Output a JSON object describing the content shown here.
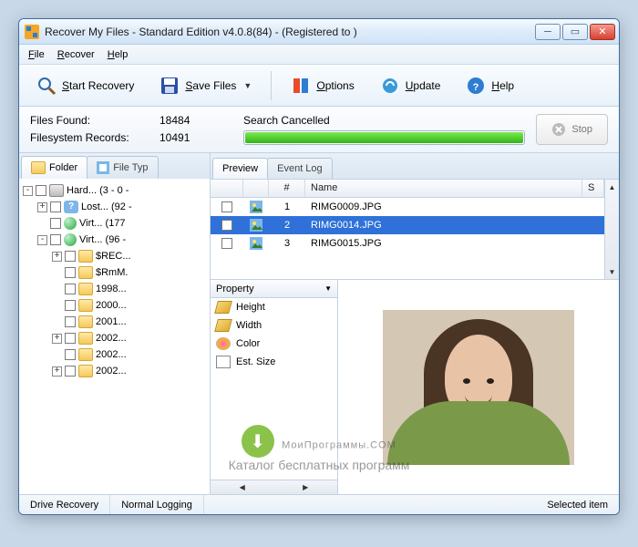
{
  "window": {
    "title": "Recover My Files - Standard Edition v4.0.8(84)  -  (Registered to )"
  },
  "menu": {
    "file": "File",
    "recover": "Recover",
    "help": "Help"
  },
  "toolbar": {
    "start_recovery": "Start Recovery",
    "save_files": "Save Files",
    "options": "Options",
    "update": "Update",
    "help": "Help"
  },
  "status": {
    "files_found_label": "Files Found:",
    "files_found_value": "18484",
    "fs_records_label": "Filesystem Records:",
    "fs_records_value": "10491",
    "search_state": "Search Cancelled",
    "stop_label": "Stop"
  },
  "left_tabs": {
    "folder": "Folder",
    "file_type": "File Typ"
  },
  "tree": [
    {
      "indent": 0,
      "exp": "-",
      "icon": "drive",
      "label": "Hard... (3 - 0 - "
    },
    {
      "indent": 1,
      "exp": "+",
      "icon": "q",
      "label": "Lost... (92 -"
    },
    {
      "indent": 1,
      "exp": " ",
      "icon": "globe",
      "label": "Virt... (177"
    },
    {
      "indent": 1,
      "exp": "-",
      "icon": "globe",
      "label": "Virt... (96 -"
    },
    {
      "indent": 2,
      "exp": "+",
      "icon": "folder",
      "label": "$REC..."
    },
    {
      "indent": 2,
      "exp": " ",
      "icon": "folder",
      "label": "$RmM."
    },
    {
      "indent": 2,
      "exp": " ",
      "icon": "folder",
      "label": "1998..."
    },
    {
      "indent": 2,
      "exp": " ",
      "icon": "folder",
      "label": "2000..."
    },
    {
      "indent": 2,
      "exp": " ",
      "icon": "folder",
      "label": "2001..."
    },
    {
      "indent": 2,
      "exp": "+",
      "icon": "folder",
      "label": "2002..."
    },
    {
      "indent": 2,
      "exp": " ",
      "icon": "folder",
      "label": "2002..."
    },
    {
      "indent": 2,
      "exp": "+",
      "icon": "folder",
      "label": "2002..."
    }
  ],
  "right_tabs": {
    "preview": "Preview",
    "event_log": "Event Log"
  },
  "file_columns": {
    "num": "#",
    "name": "Name",
    "s": "S"
  },
  "files": [
    {
      "num": "1",
      "name": "RIMG0009.JPG",
      "sel": false
    },
    {
      "num": "2",
      "name": "RIMG0014.JPG",
      "sel": true
    },
    {
      "num": "3",
      "name": "RIMG0015.JPG",
      "sel": false
    }
  ],
  "props_header": "Property",
  "props": [
    {
      "icon": "ruler",
      "label": "Height"
    },
    {
      "icon": "ruler",
      "label": "Width"
    },
    {
      "icon": "palette",
      "label": "Color"
    },
    {
      "icon": "doc",
      "label": "Est. Size"
    }
  ],
  "statusbar": {
    "left": "Drive Recovery",
    "mid": "Normal Logging",
    "right": "Selected item"
  },
  "watermark": {
    "line1": "МоиПрограммы.COM",
    "line2": "Каталог бесплатных программ"
  }
}
